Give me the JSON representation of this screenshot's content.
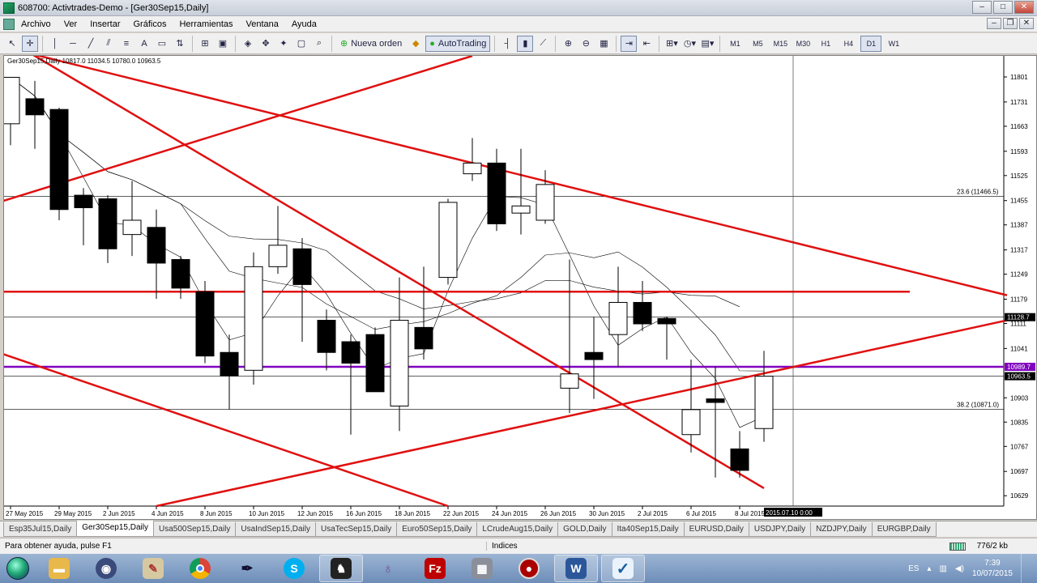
{
  "window": {
    "title": "608700: Activtrades-Demo - [Ger30Sep15,Daily]",
    "controls": [
      "‒",
      "□",
      "✕"
    ],
    "inner_controls": [
      "‒",
      "❐",
      "✕"
    ]
  },
  "menu": [
    "Archivo",
    "Ver",
    "Insertar",
    "Gráficos",
    "Herramientas",
    "Ventana",
    "Ayuda"
  ],
  "toolbar": {
    "new_order": "Nueva orden",
    "autotrading": "AutoTrading",
    "timeframes": [
      "M1",
      "M5",
      "M15",
      "M30",
      "H1",
      "H4",
      "D1",
      "W1"
    ],
    "active_timeframe": "D1"
  },
  "chart": {
    "header": "Ger30Sep15,Daily  10817.0 11034.5 10780.0 10963.5",
    "fib_236": "23.6 (11466.5)",
    "fib_382": "38.2 (10871.0)",
    "crosshair_date": "2015.07.10 0:00",
    "colors": {
      "up": "#ffffff",
      "down": "#000000",
      "trend": "#e01010",
      "purple": "#8000c0"
    }
  },
  "chart_data": {
    "type": "candlestick",
    "symbol": "Ger30Sep15",
    "timeframe": "Daily",
    "ylim": [
      10600,
      11860
    ],
    "y_ticks": [
      11801,
      11731,
      11663,
      11593,
      11525,
      11455,
      11387,
      11317,
      11249,
      11179,
      11111,
      11041,
      10903,
      10835,
      10767,
      10697,
      10629
    ],
    "x_ticks": [
      "27 May 2015",
      "29 May 2015",
      "2 Jun 2015",
      "4 Jun 2015",
      "8 Jun 2015",
      "10 Jun 2015",
      "12 Jun 2015",
      "16 Jun 2015",
      "18 Jun 2015",
      "22 Jun 2015",
      "24 Jun 2015",
      "26 Jun 2015",
      "30 Jun 2015",
      "2 Jul 2015",
      "6 Jul 2015",
      "8 Jul 2015"
    ],
    "price_labels": [
      {
        "value": 11128.7,
        "text": "11128.7",
        "style": "black"
      },
      {
        "value": 10989.7,
        "text": "10989.7",
        "style": "purple"
      },
      {
        "value": 10963.5,
        "text": "10963.5",
        "style": "black"
      }
    ],
    "candles": [
      {
        "o": 11670,
        "h": 11780,
        "l": 11610,
        "c": 11800
      },
      {
        "o": 11740,
        "h": 11790,
        "l": 11600,
        "c": 11695
      },
      {
        "o": 11710,
        "h": 11715,
        "l": 11400,
        "c": 11430
      },
      {
        "o": 11470,
        "h": 11490,
        "l": 11330,
        "c": 11435
      },
      {
        "o": 11460,
        "h": 11470,
        "l": 11280,
        "c": 11320
      },
      {
        "o": 11360,
        "h": 11510,
        "l": 11300,
        "c": 11400
      },
      {
        "o": 11380,
        "h": 11430,
        "l": 11180,
        "c": 11280
      },
      {
        "o": 11290,
        "h": 11300,
        "l": 11180,
        "c": 11210
      },
      {
        "o": 11200,
        "h": 11230,
        "l": 11000,
        "c": 11020
      },
      {
        "o": 11030,
        "h": 11080,
        "l": 10870,
        "c": 10965
      },
      {
        "o": 10980,
        "h": 11310,
        "l": 10940,
        "c": 11270
      },
      {
        "o": 11270,
        "h": 11440,
        "l": 11250,
        "c": 11330
      },
      {
        "o": 11320,
        "h": 11350,
        "l": 11060,
        "c": 11220
      },
      {
        "o": 11120,
        "h": 11150,
        "l": 10980,
        "c": 11030
      },
      {
        "o": 11060,
        "h": 11080,
        "l": 10800,
        "c": 11000
      },
      {
        "o": 11080,
        "h": 11100,
        "l": 10920,
        "c": 10920
      },
      {
        "o": 10880,
        "h": 11240,
        "l": 10810,
        "c": 11120
      },
      {
        "o": 11100,
        "h": 11270,
        "l": 11010,
        "c": 11040
      },
      {
        "o": 11240,
        "h": 11460,
        "l": 11220,
        "c": 11450
      },
      {
        "o": 11530,
        "h": 11630,
        "l": 11510,
        "c": 11560
      },
      {
        "o": 11560,
        "h": 11600,
        "l": 11370,
        "c": 11390
      },
      {
        "o": 11420,
        "h": 11600,
        "l": 11360,
        "c": 11440
      },
      {
        "o": 11400,
        "h": 11540,
        "l": 11390,
        "c": 11500
      },
      {
        "o": 10930,
        "h": 11290,
        "l": 10860,
        "c": 10970
      },
      {
        "o": 11030,
        "h": 11130,
        "l": 10900,
        "c": 11010
      },
      {
        "o": 11080,
        "h": 11270,
        "l": 10990,
        "c": 11170
      },
      {
        "o": 11170,
        "h": 11230,
        "l": 11090,
        "c": 11110
      },
      {
        "o": 11125,
        "h": 11130,
        "l": 11010,
        "c": 11110
      },
      {
        "o": 10800,
        "h": 11010,
        "l": 10750,
        "c": 10870
      },
      {
        "o": 10900,
        "h": 10990,
        "l": 10680,
        "c": 10890
      },
      {
        "o": 10760,
        "h": 10810,
        "l": 10680,
        "c": 10700
      },
      {
        "o": 10817,
        "h": 11034.5,
        "l": 10780,
        "c": 10963.5
      }
    ],
    "fib_levels": [
      {
        "label": "23.6 (11466.5)",
        "value": 11466.5
      },
      {
        "label": "38.2 (10871.0)",
        "value": 10871.0
      }
    ],
    "horizontal_lines": [
      {
        "value": 11200,
        "color": "red"
      },
      {
        "value": 10989.7,
        "color": "purple"
      },
      {
        "value": 11128.7,
        "color": "black"
      },
      {
        "value": 10963.5,
        "color": "black"
      }
    ]
  },
  "tabs": [
    "Esp35Jul15,Daily",
    "Ger30Sep15,Daily",
    "Usa500Sep15,Daily",
    "UsaIndSep15,Daily",
    "UsaTecSep15,Daily",
    "Euro50Sep15,Daily",
    "LCrudeAug15,Daily",
    "GOLD,Daily",
    "Ita40Sep15,Daily",
    "EURUSD,Daily",
    "USDJPY,Daily",
    "NZDJPY,Daily",
    "EURGBP,Daily"
  ],
  "active_tab": "Ger30Sep15,Daily",
  "status": {
    "help": "Para obtener ayuda, pulse F1",
    "profile": "Indices",
    "connection": "776/2 kb"
  },
  "taskbar": {
    "lang": "ES",
    "time": "7:39",
    "date": "10/07/2015",
    "apps": [
      "explorer",
      "security",
      "paint",
      "chrome",
      "inkscape",
      "skype",
      "metatrader",
      "tor",
      "filezilla",
      "virtualbox",
      "record",
      "word",
      "mt4-check"
    ]
  }
}
